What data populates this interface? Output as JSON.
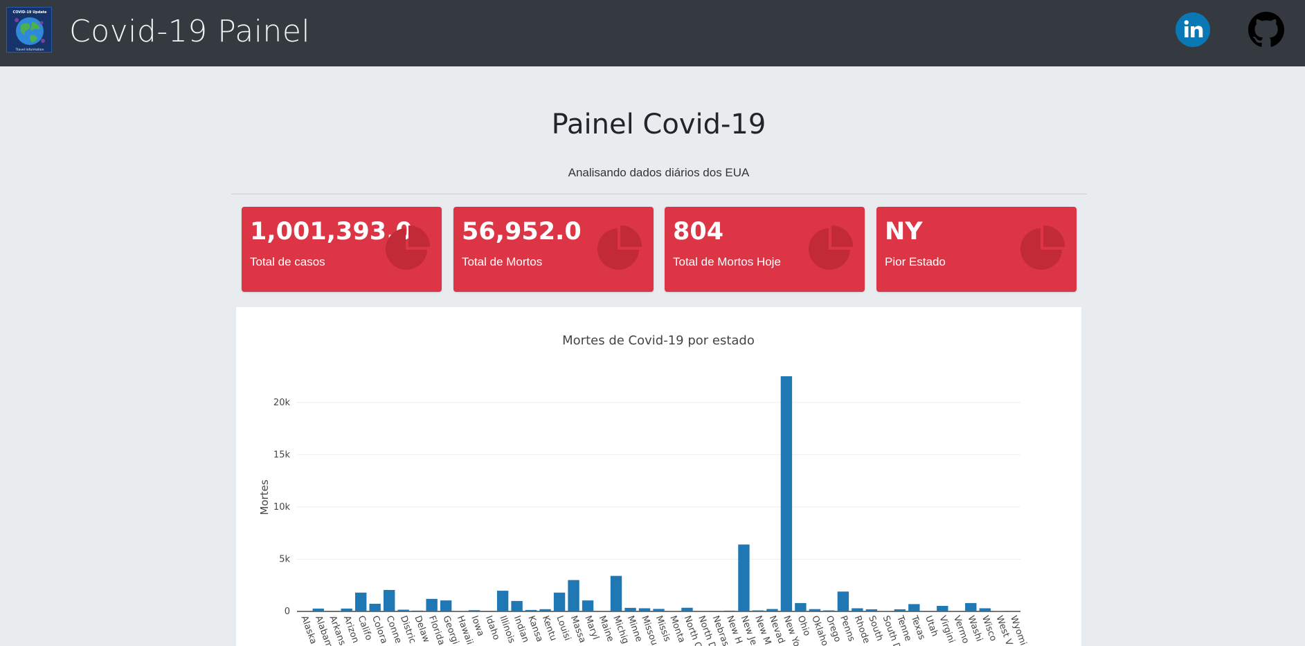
{
  "navbar": {
    "brand": "Covid-19 Painel",
    "logo_text_top": "COVID-19 Update",
    "logo_text_bottom": "Travel Information",
    "linkedin_icon": "linkedin-icon",
    "github_icon": "github-icon"
  },
  "header": {
    "title": "Painel Covid-19",
    "subtitle": "Analisando dados diários dos EUA"
  },
  "cards": [
    {
      "value": "1,001,393.0",
      "label": "Total de casos",
      "icon": "pie-chart-icon"
    },
    {
      "value": "56,952.0",
      "label": "Total de Mortos",
      "icon": "pie-chart-icon"
    },
    {
      "value": "804",
      "label": "Total de Mortos Hoje",
      "icon": "pie-chart-icon"
    },
    {
      "value": "NY",
      "label": "Pior Estado",
      "icon": "pie-chart-icon"
    }
  ],
  "colors": {
    "navbar": "#343a40",
    "card": "#dc3545",
    "bar": "#1f77b4",
    "background": "#e9ecef"
  },
  "chart_data": {
    "type": "bar",
    "title": "Mortes de Covid-19 por estado",
    "xlabel": "",
    "ylabel": "Mortes",
    "ylim": [
      0,
      22500
    ],
    "yticks": [
      0,
      5000,
      10000,
      15000,
      20000
    ],
    "ytick_labels": [
      "0",
      "5k",
      "10k",
      "15k",
      "20k"
    ],
    "grid": true,
    "categories": [
      "Alaska",
      "Alabama",
      "Arkansas",
      "Arizona",
      "California",
      "Colorado",
      "Connecticut",
      "District of Columbia",
      "Delaware",
      "Florida",
      "Georgia",
      "Hawaii",
      "Iowa",
      "Idaho",
      "Illinois",
      "Indiana",
      "Kansas",
      "Kentucky",
      "Louisiana",
      "Massachusetts",
      "Maryland",
      "Maine",
      "Michigan",
      "Minnesota",
      "Missouri",
      "Mississippi",
      "Montana",
      "North Carolina",
      "North Dakota",
      "Nebraska",
      "New Hampshire",
      "New Jersey",
      "New Mexico",
      "Nevada",
      "New York",
      "Ohio",
      "Oklahoma",
      "Oregon",
      "Pennsylvania",
      "Rhode Island",
      "South Carolina",
      "South Dakota",
      "Tennessee",
      "Texas",
      "Utah",
      "Virginia",
      "Vermont",
      "Washington",
      "Wisconsin",
      "West Virginia",
      "Wyoming"
    ],
    "tick_labels": [
      "Alaska",
      "Alabam",
      "Arkans",
      "Arizon",
      "Califo",
      "Colora",
      "Conne",
      "Distric",
      "Delaw",
      "Florida",
      "Georgi",
      "Hawaii",
      "Iowa",
      "Idaho",
      "Illinois",
      "Indian",
      "Kansa",
      "Kentu",
      "Louisi",
      "Massa",
      "Maryl",
      "Maine",
      "Michig",
      "Minne",
      "Missou",
      "Missis",
      "Monta",
      "North C",
      "North D",
      "Nebras",
      "New H",
      "New Je",
      "New M",
      "Nevad",
      "New Yo",
      "Ohio",
      "Oklaho",
      "Orego",
      "Penns",
      "Rhode",
      "South",
      "South D",
      "Tenne",
      "Texas",
      "Utah",
      "Virgini",
      "Vermo",
      "Washi",
      "Wisco",
      "West V",
      "Wyomi"
    ],
    "values": [
      9,
      272,
      61,
      273,
      1800,
      733,
      2050,
      165,
      79,
      1200,
      1050,
      16,
      118,
      60,
      1980,
      1000,
      140,
      213,
      1800,
      3000,
      1050,
      50,
      3400,
      340,
      300,
      240,
      16,
      350,
      10,
      55,
      76,
      6400,
      100,
      230,
      22500,
      800,
      220,
      100,
      1900,
      300,
      200,
      6,
      200,
      700,
      50,
      530,
      47,
      800,
      300,
      26,
      7
    ]
  }
}
